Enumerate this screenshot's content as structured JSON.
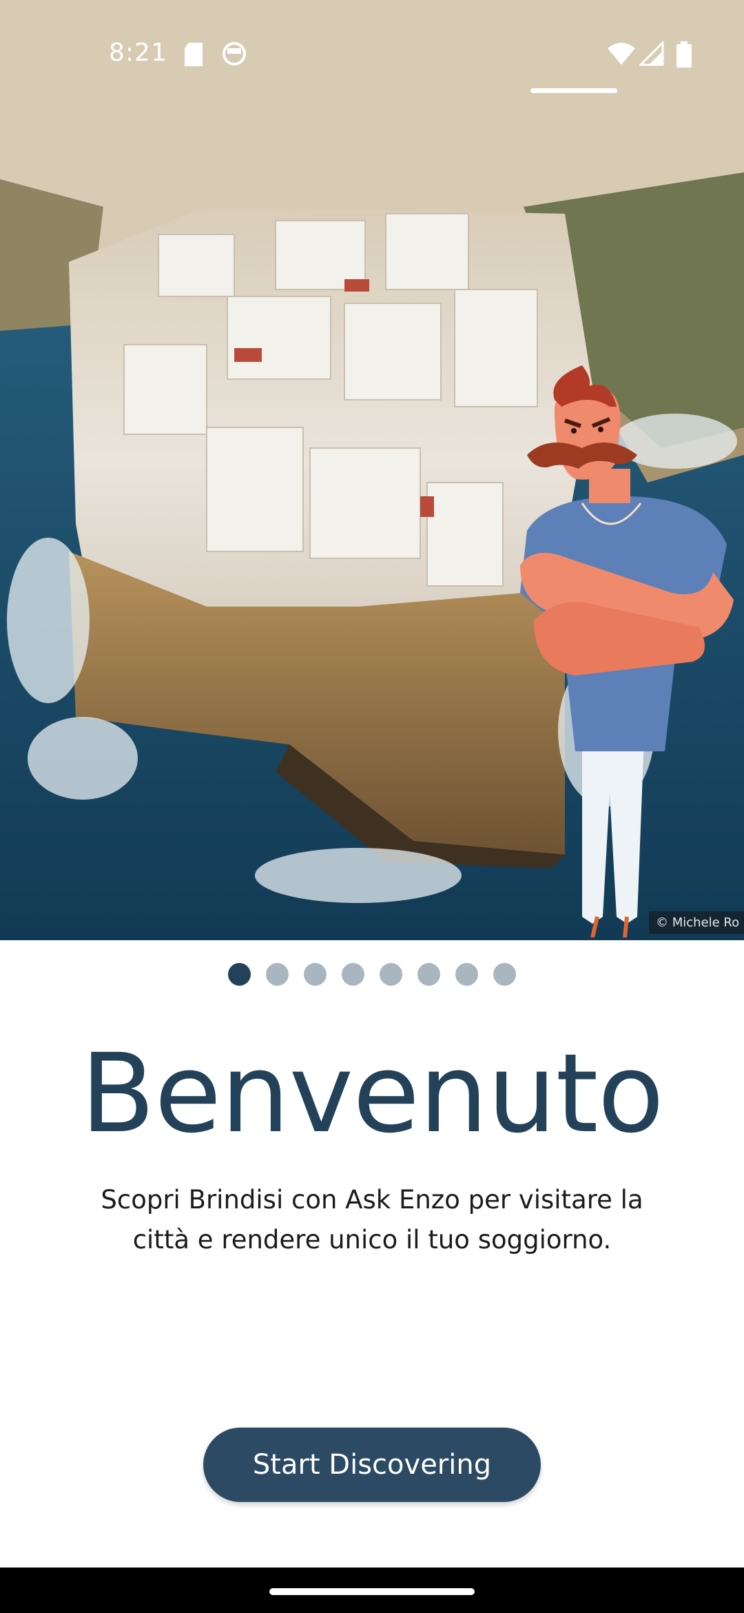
{
  "status_bar": {
    "time": "8:21",
    "icons": [
      "sd-card-icon",
      "face-icon",
      "wifi-icon",
      "signal-icon",
      "battery-icon"
    ]
  },
  "hero": {
    "photo_credit": "© Michele Ro",
    "mascot": "mascot-character"
  },
  "onboarding": {
    "page_count": 8,
    "active_page": 1,
    "title": "Benvenuto",
    "subtitle_line1": "Scopri Brindisi con Ask Enzo per visitare la",
    "subtitle_line2": "città e rendere unico il tuo soggiorno.",
    "cta_label": "Start Discovering"
  },
  "colors": {
    "primary": "#234259",
    "button": "#2c4a63",
    "dot_inactive": "#a9b6bf"
  }
}
